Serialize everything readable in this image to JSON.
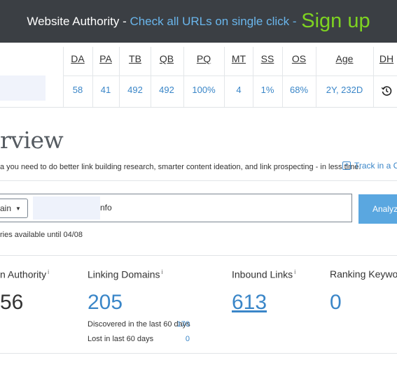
{
  "banner": {
    "title": "Website Authority",
    "separator": " - ",
    "cta_text": "Check all URLs on single click",
    "separator2": " - ",
    "signup": "Sign up"
  },
  "metrics": {
    "headers": [
      "DA",
      "PA",
      "TB",
      "QB",
      "PQ",
      "MT",
      "SS",
      "OS",
      "Age",
      "DH"
    ],
    "values": [
      "58",
      "41",
      "492",
      "492",
      "100%",
      "4",
      "1%",
      "68%",
      "2Y, 232D"
    ],
    "history_icon": "history-clock-icon"
  },
  "overview": {
    "title": "rview",
    "description": "a you need to do better link building research, smarter content ideation, and link prospecting - in less time.",
    "track_link": "Track in a Camp",
    "track_icon": "plus-box-icon"
  },
  "search": {
    "select_value": "ain",
    "url_value": "nfo",
    "analyze_label": "Analyze",
    "queries_note": "ries available until 04/08"
  },
  "stats": {
    "domain_authority": {
      "label": "n Authority",
      "value": "56"
    },
    "linking_domains": {
      "label": "Linking Domains",
      "value": "205",
      "discovered_label": "Discovered in the last 60 days",
      "discovered_value": "170",
      "lost_label": "Lost in last 60 days",
      "lost_value": "0"
    },
    "inbound_links": {
      "label": "Inbound Links",
      "value": "613"
    },
    "ranking_keywords": {
      "label": "Ranking Keywords",
      "value": "0"
    },
    "info_marker": "i"
  },
  "colors": {
    "banner_bg": "#3b3f44",
    "link_blue": "#3a86c8",
    "signup_green": "#7ed321",
    "analyze_blue": "#5aa7e0"
  }
}
